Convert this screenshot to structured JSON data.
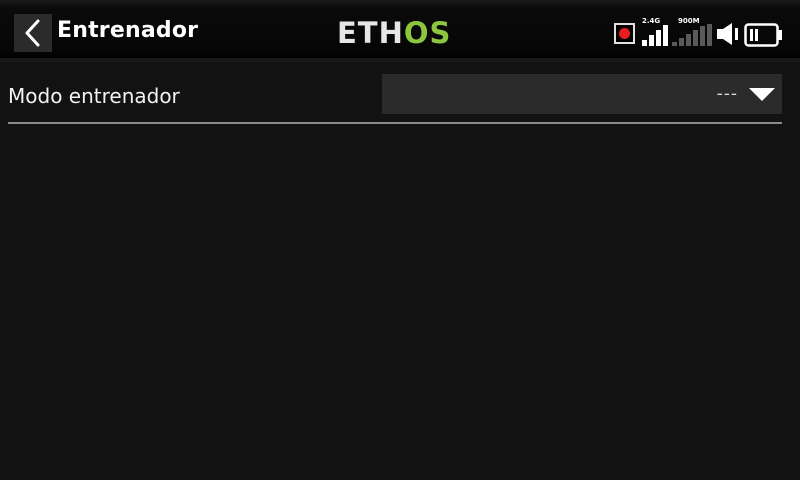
{
  "header": {
    "title": "Entrenador",
    "logo_left": "ETH",
    "logo_right": "OS"
  },
  "status": {
    "radio_24g_label": "2.4G",
    "radio_900m_label": "900M",
    "radio_24g_level": 4,
    "radio_900m_level": 0,
    "recording": true,
    "battery_level_fraction": 0.5
  },
  "settings": {
    "trainer_mode_label": "Modo entrenador",
    "trainer_mode_value": "---"
  },
  "colors": {
    "accent": "#8cc63e",
    "record": "#e81d1d",
    "background": "#121212",
    "field": "#2b2b2b"
  }
}
